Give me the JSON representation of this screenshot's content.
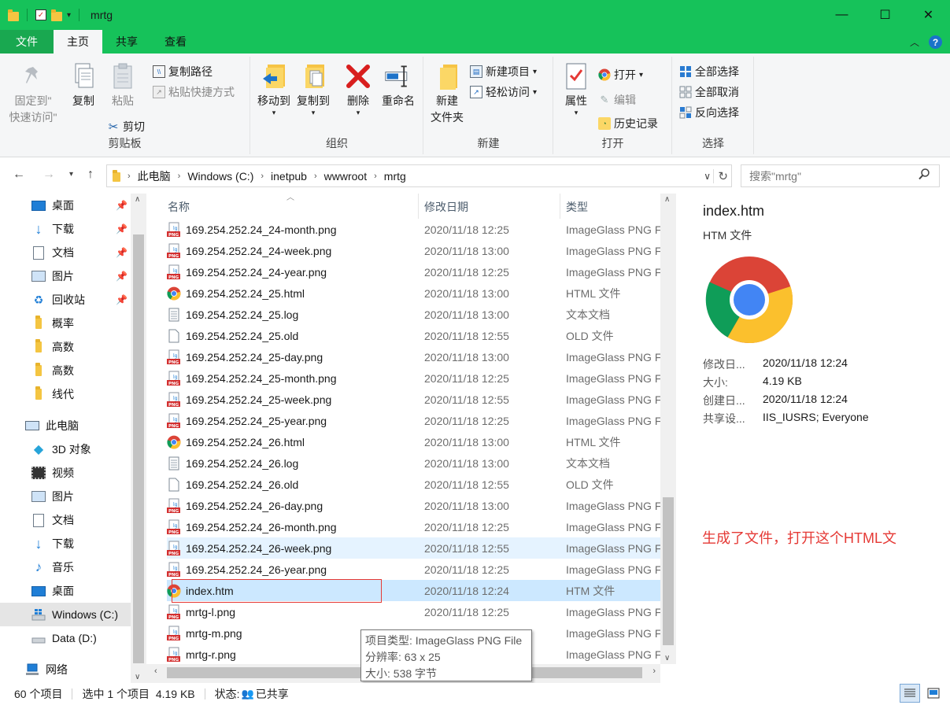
{
  "window": {
    "title": "mrtg",
    "minimize": "—",
    "maximize": "☐",
    "close": "✕"
  },
  "tabs": [
    {
      "label": "文件"
    },
    {
      "label": "主页"
    },
    {
      "label": "共享"
    },
    {
      "label": "查看"
    }
  ],
  "ribbon": {
    "clipboard": {
      "label": "剪贴板",
      "pin": "固定到\"\n快速访问\"",
      "pin_l1": "固定到\"",
      "pin_l2": "快速访问\"",
      "copy": "复制",
      "paste": "粘贴",
      "copy_path": "复制路径",
      "paste_shortcut": "粘贴快捷方式",
      "cut": "剪切"
    },
    "organize": {
      "label": "组织",
      "move_to": "移动到",
      "copy_to": "复制到",
      "delete": "删除",
      "rename": "重命名"
    },
    "new": {
      "label": "新建",
      "new_folder_l1": "新建",
      "new_folder_l2": "文件夹",
      "new_item": "新建项目",
      "easy_access": "轻松访问"
    },
    "open": {
      "label": "打开",
      "properties": "属性",
      "open": "打开",
      "edit": "编辑",
      "history": "历史记录"
    },
    "select": {
      "label": "选择",
      "select_all": "全部选择",
      "select_none": "全部取消",
      "invert": "反向选择"
    }
  },
  "address": {
    "crumbs": [
      "此电脑",
      "Windows (C:)",
      "inetpub",
      "wwwroot",
      "mrtg"
    ],
    "search_placeholder": "搜索\"mrtg\""
  },
  "nav": {
    "quick": [
      {
        "label": "桌面",
        "icon": "desktop-icon",
        "pinned": true
      },
      {
        "label": "下载",
        "icon": "download-icon",
        "pinned": true
      },
      {
        "label": "文档",
        "icon": "document-icon",
        "pinned": true
      },
      {
        "label": "图片",
        "icon": "picture-icon",
        "pinned": true
      },
      {
        "label": "回收站",
        "icon": "recycle-bin-icon",
        "pinned": true
      },
      {
        "label": "概率",
        "icon": "folder-icon",
        "pinned": false
      },
      {
        "label": "高数",
        "icon": "folder-icon",
        "pinned": false
      },
      {
        "label": "高数",
        "icon": "folder-icon",
        "pinned": false
      },
      {
        "label": "线代",
        "icon": "folder-icon",
        "pinned": false
      }
    ],
    "this_pc": "此电脑",
    "pc_items": [
      {
        "label": "3D 对象",
        "icon": "3d-objects-icon"
      },
      {
        "label": "视频",
        "icon": "video-icon"
      },
      {
        "label": "图片",
        "icon": "picture-icon"
      },
      {
        "label": "文档",
        "icon": "document-icon"
      },
      {
        "label": "下载",
        "icon": "download-icon"
      },
      {
        "label": "音乐",
        "icon": "music-icon"
      },
      {
        "label": "桌面",
        "icon": "desktop-icon"
      },
      {
        "label": "Windows (C:)",
        "icon": "windows-drive-icon"
      },
      {
        "label": "Data (D:)",
        "icon": "drive-icon"
      }
    ],
    "network": "网络"
  },
  "columns": {
    "name": "名称",
    "date": "修改日期",
    "type": "类型"
  },
  "files": [
    {
      "name": "169.254.252.24_24-month.png",
      "date": "2020/11/18 12:25",
      "type": "ImageGlass PNG F",
      "icon": "png"
    },
    {
      "name": "169.254.252.24_24-week.png",
      "date": "2020/11/18 13:00",
      "type": "ImageGlass PNG F",
      "icon": "png"
    },
    {
      "name": "169.254.252.24_24-year.png",
      "date": "2020/11/18 12:25",
      "type": "ImageGlass PNG F",
      "icon": "png"
    },
    {
      "name": "169.254.252.24_25.html",
      "date": "2020/11/18 13:00",
      "type": "HTML 文件",
      "icon": "chrome"
    },
    {
      "name": "169.254.252.24_25.log",
      "date": "2020/11/18 13:00",
      "type": "文本文档",
      "icon": "text"
    },
    {
      "name": "169.254.252.24_25.old",
      "date": "2020/11/18 12:55",
      "type": "OLD 文件",
      "icon": "blank"
    },
    {
      "name": "169.254.252.24_25-day.png",
      "date": "2020/11/18 13:00",
      "type": "ImageGlass PNG F",
      "icon": "png"
    },
    {
      "name": "169.254.252.24_25-month.png",
      "date": "2020/11/18 12:25",
      "type": "ImageGlass PNG F",
      "icon": "png"
    },
    {
      "name": "169.254.252.24_25-week.png",
      "date": "2020/11/18 12:55",
      "type": "ImageGlass PNG F",
      "icon": "png"
    },
    {
      "name": "169.254.252.24_25-year.png",
      "date": "2020/11/18 12:25",
      "type": "ImageGlass PNG F",
      "icon": "png"
    },
    {
      "name": "169.254.252.24_26.html",
      "date": "2020/11/18 13:00",
      "type": "HTML 文件",
      "icon": "chrome"
    },
    {
      "name": "169.254.252.24_26.log",
      "date": "2020/11/18 13:00",
      "type": "文本文档",
      "icon": "text"
    },
    {
      "name": "169.254.252.24_26.old",
      "date": "2020/11/18 12:55",
      "type": "OLD 文件",
      "icon": "blank"
    },
    {
      "name": "169.254.252.24_26-day.png",
      "date": "2020/11/18 13:00",
      "type": "ImageGlass PNG F",
      "icon": "png"
    },
    {
      "name": "169.254.252.24_26-month.png",
      "date": "2020/11/18 12:25",
      "type": "ImageGlass PNG F",
      "icon": "png"
    },
    {
      "name": "169.254.252.24_26-week.png",
      "date": "2020/11/18 12:55",
      "type": "ImageGlass PNG F",
      "icon": "png",
      "state": "hover"
    },
    {
      "name": "169.254.252.24_26-year.png",
      "date": "2020/11/18 12:25",
      "type": "ImageGlass PNG F",
      "icon": "png"
    },
    {
      "name": "index.htm",
      "date": "2020/11/18 12:24",
      "type": "HTM 文件",
      "icon": "chrome",
      "state": "selected"
    },
    {
      "name": "mrtg-l.png",
      "date": "2020/11/18 12:25",
      "type": "ImageGlass PNG F",
      "icon": "png"
    },
    {
      "name": "mrtg-m.png",
      "date": "2020/11/18 12:25",
      "type": "ImageGlass PNG F",
      "icon": "png"
    },
    {
      "name": "mrtg-r.png",
      "date": "2020/11/18 12:25",
      "type": "ImageGlass PNG F",
      "icon": "png"
    }
  ],
  "details": {
    "title": "index.htm",
    "subtitle": "HTM 文件",
    "props": [
      {
        "label": "修改日...",
        "value": "2020/11/18 12:24"
      },
      {
        "label": "大小:",
        "value": "4.19 KB"
      },
      {
        "label": "创建日...",
        "value": "2020/11/18 12:24"
      },
      {
        "label": "共享设...",
        "value": "IIS_IUSRS; Everyone"
      }
    ],
    "annotation": "生成了文件，打开这个HTML文"
  },
  "tooltip": {
    "line1": "项目类型: ImageGlass PNG File",
    "line2": "分辨率: 63 x 25",
    "line3": "大小: 538 字节"
  },
  "status": {
    "count": "60 个项目",
    "selected": "选中 1 个项目  4.19 KB",
    "state_label": "状态:",
    "state_value": "已共享"
  },
  "colors": {
    "titlebar": "#16c25a",
    "selection": "#cce8ff",
    "hover": "#e5f3ff",
    "annotation": "#e53935"
  }
}
